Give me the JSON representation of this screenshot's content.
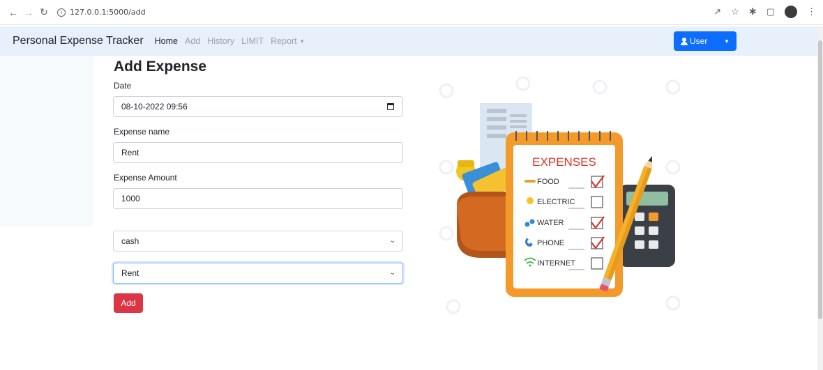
{
  "browser": {
    "url": "127.0.0.1:5000/add"
  },
  "navbar": {
    "brand": "Personal Expense Tracker",
    "links": [
      {
        "label": "Home"
      },
      {
        "label": "Add"
      },
      {
        "label": "History"
      },
      {
        "label": "LIMIT"
      },
      {
        "label": "Report"
      }
    ],
    "user_label": "User"
  },
  "form": {
    "title": "Add Expense",
    "date_label": "Date",
    "date_value": "08-10-2022 09:56",
    "name_label": "Expense name",
    "name_value": "Rent",
    "amount_label": "Expense Amount",
    "amount_value": "1000",
    "payment_select": "cash",
    "category_select": "Rent",
    "submit_label": "Add"
  },
  "illustration": {
    "title": "EXPENSES",
    "items": [
      {
        "label": "FOOD",
        "checked": true
      },
      {
        "label": "ELECTRIC",
        "checked": false
      },
      {
        "label": "WATER",
        "checked": true
      },
      {
        "label": "PHONE",
        "checked": true
      },
      {
        "label": "INTERNET",
        "checked": false
      }
    ]
  },
  "colors": {
    "primary": "#0d6efd",
    "danger": "#dc3545",
    "navbar_bg": "#e7f0fb",
    "notepad": "#f39a2b"
  }
}
